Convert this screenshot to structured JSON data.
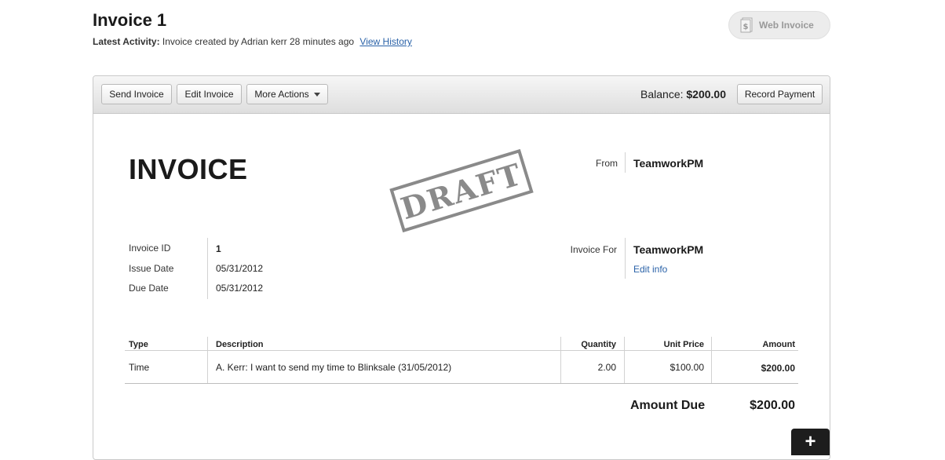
{
  "header": {
    "title": "Invoice 1",
    "activity_label": "Latest Activity:",
    "activity_text": "Invoice created by Adrian kerr 28 minutes ago",
    "view_history": "View History",
    "web_invoice": "Web Invoice"
  },
  "toolbar": {
    "send_invoice": "Send Invoice",
    "edit_invoice": "Edit Invoice",
    "more_actions": "More Actions",
    "balance_label": "Balance:",
    "balance_value": "$200.00",
    "record_payment": "Record Payment"
  },
  "invoice": {
    "heading": "INVOICE",
    "stamp": "DRAFT",
    "from_label": "From",
    "from_value": "TeamworkPM",
    "id_label": "Invoice ID",
    "id_value": "1",
    "issue_label": "Issue Date",
    "issue_value": "05/31/2012",
    "due_label": "Due Date",
    "due_value": "05/31/2012",
    "for_label": "Invoice For",
    "for_value": "TeamworkPM",
    "edit_info": "Edit info"
  },
  "table": {
    "headers": [
      "Type",
      "Description",
      "Quantity",
      "Unit Price",
      "Amount"
    ],
    "rows": [
      [
        "Time",
        "A. Kerr: I want to send my time to Blinksale (31/05/2012)",
        "2.00",
        "$100.00",
        "$200.00"
      ]
    ],
    "amount_due_label": "Amount Due",
    "amount_due_value": "$200.00"
  },
  "fab": {
    "label": "+"
  },
  "icons": {
    "web_invoice": "invoice-dollar-icon",
    "more_actions": "caret-down-icon",
    "fab": "plus-icon"
  }
}
